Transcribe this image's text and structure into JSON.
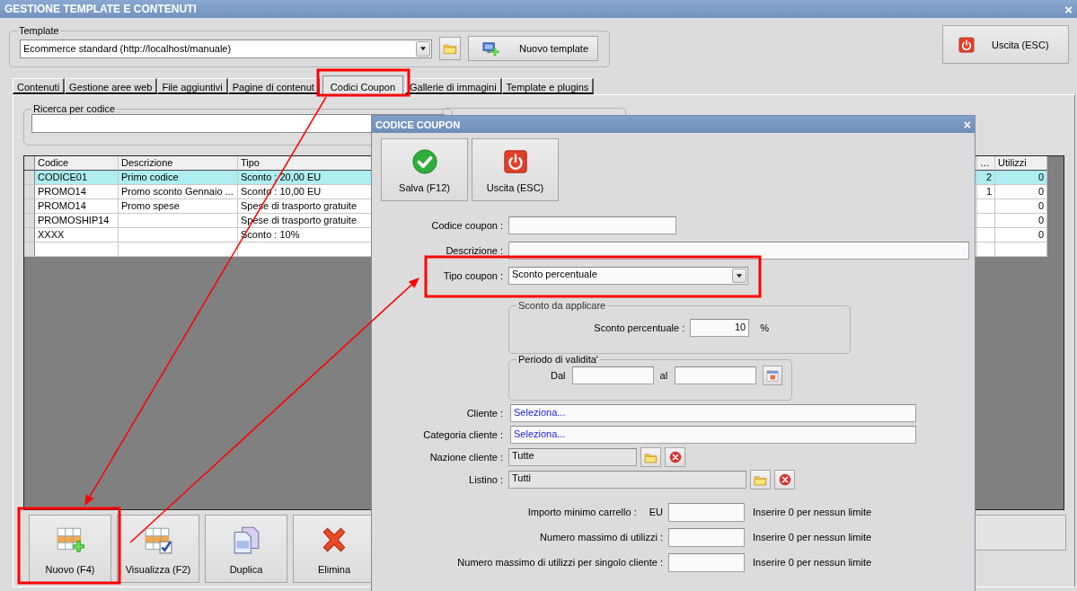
{
  "window": {
    "title": "GESTIONE TEMPLATE E CONTENUTI",
    "close": "×"
  },
  "template": {
    "label": "Template",
    "value": "Ecommerce standard (http://localhost/manuale)",
    "new_button": "Nuovo template"
  },
  "exit_button": "Uscita (ESC)",
  "tabs": [
    {
      "label": "Contenuti",
      "selected": false
    },
    {
      "label": "Gestione aree web",
      "selected": false
    },
    {
      "label": "File aggiuntivi",
      "selected": false
    },
    {
      "label": "Pagine di contenut",
      "selected": false
    },
    {
      "label": "Codici Coupon",
      "selected": true
    },
    {
      "label": "Gallerie di immagini",
      "selected": false
    },
    {
      "label": "Template e plugins",
      "selected": false
    }
  ],
  "search": {
    "label": "Ricerca per codice"
  },
  "grid": {
    "columns": [
      "Codice",
      "Descrizione",
      "Tipo",
      "…",
      "Utilizzi"
    ],
    "rows": [
      {
        "cells": [
          "CODICE01",
          "Primo codice",
          "Sconto : 20,00 EU",
          "2",
          "0"
        ],
        "selected": true
      },
      {
        "cells": [
          "PROMO14",
          "Promo sconto Gennaio ...",
          "Sconto : 10,00 EU",
          "1",
          "0"
        ],
        "selected": false
      },
      {
        "cells": [
          "PROMO14",
          "Promo spese",
          "Spese di trasporto gratuite",
          "",
          "0"
        ],
        "selected": false
      },
      {
        "cells": [
          "PROMOSHIP14",
          "",
          "Spese di trasporto gratuite",
          "",
          "0"
        ],
        "selected": false
      },
      {
        "cells": [
          "XXXX",
          "",
          "Sconto : 10%",
          "",
          "0"
        ],
        "selected": false
      }
    ]
  },
  "toolbar": [
    {
      "label": "Nuovo (F4)",
      "kind": "new"
    },
    {
      "label": "Visualizza (F2)",
      "kind": "view"
    },
    {
      "label": "Duplica",
      "kind": "duplicate"
    },
    {
      "label": "Elimina",
      "kind": "delete"
    }
  ],
  "dialog": {
    "title": "CODICE COUPON",
    "close": "×",
    "buttons": [
      {
        "label": "Salva (F12)",
        "kind": "save"
      },
      {
        "label": "Uscita (ESC)",
        "kind": "exit"
      }
    ],
    "codice_coupon": {
      "label": "Codice coupon :"
    },
    "descrizione": {
      "label": "Descrizione :"
    },
    "tipo_coupon": {
      "label": "Tipo coupon :",
      "value": "Sconto percentuale"
    },
    "sconto": {
      "title": "Sconto da applicare",
      "label": "Sconto percentuale :",
      "value": "10",
      "unit": "%"
    },
    "periodo": {
      "title": "Periodo di validita'",
      "from_label": "Dal",
      "to_label": "al"
    },
    "cliente": {
      "label": "Cliente :",
      "value": "Seleziona..."
    },
    "categoria_cliente": {
      "label": "Categoria cliente :",
      "value": "Seleziona..."
    },
    "nazione_cliente": {
      "label": "Nazione cliente :",
      "value": "Tutte"
    },
    "listino": {
      "label": "Listino :",
      "value": "Tutti"
    },
    "limits": [
      {
        "label": "Importo minimo carrello :",
        "unit": "EU",
        "hint": "Inserire 0 per nessun limite"
      },
      {
        "label": "Numero massimo di utilizzi :",
        "hint": "Inserire 0 per nessun limite"
      },
      {
        "label": "Numero massimo di utilizzi per singolo cliente :",
        "hint": "Inserire 0 per nessun limite"
      }
    ]
  }
}
